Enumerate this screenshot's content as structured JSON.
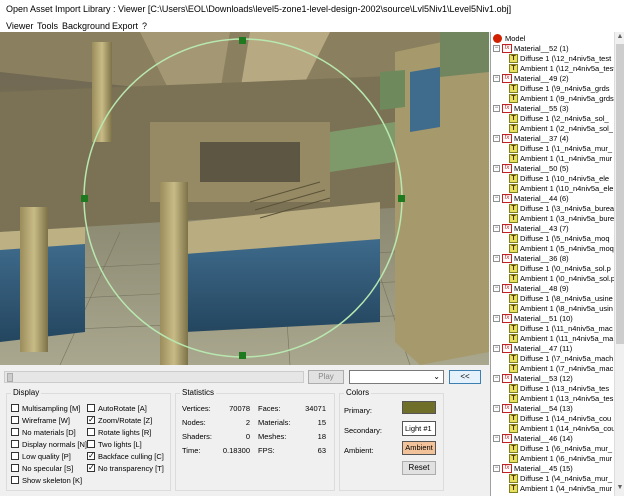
{
  "window": {
    "title": "Open Asset Import Library : Viewer  [C:\\Users\\EOL\\Downloads\\level5-zone1-level-design-2002\\source\\Lvl5Niv1\\Level5Niv1.obj]"
  },
  "menu": [
    "Viewer",
    "Tools",
    "Background",
    "Export",
    "?"
  ],
  "tree": {
    "root": "Model",
    "materials": [
      {
        "name": "Material__52 (1)",
        "diffuse": "Diffuse 1 (\\12_n4niv5a_test",
        "ambient": "Ambient 1 (\\12_n4niv5a_test"
      },
      {
        "name": "Material__49 (2)",
        "diffuse": "Diffuse 1 (\\9_n4niv5a_grds",
        "ambient": "Ambient 1 (\\9_n4niv5a_grds"
      },
      {
        "name": "Material__55 (3)",
        "diffuse": "Diffuse 1 (\\2_n4niv5a_sol_",
        "ambient": "Ambient 1 (\\2_n4niv5a_sol_"
      },
      {
        "name": "Material__37 (4)",
        "diffuse": "Diffuse 1 (\\1_n4niv5a_mur_",
        "ambient": "Ambient 1 (\\1_n4niv5a_mur"
      },
      {
        "name": "Material__50 (5)",
        "diffuse": "Diffuse 1 (\\10_n4niv5a_ele",
        "ambient": "Ambient 1 (\\10_n4niv5a_ele"
      },
      {
        "name": "Material__44 (6)",
        "diffuse": "Diffuse 1 (\\3_n4niv5a_burea",
        "ambient": "Ambient 1 (\\3_n4niv5a_bure"
      },
      {
        "name": "Material__43 (7)",
        "diffuse": "Diffuse 1 (\\5_n4niv5a_moq",
        "ambient": "Ambient 1 (\\5_n4niv5a_moq"
      },
      {
        "name": "Material__36 (8)",
        "diffuse": "Diffuse 1 (\\0_n4niv5a_sol.p",
        "ambient": "Ambient 1 (\\0_n4niv5a_sol.p"
      },
      {
        "name": "Material__48 (9)",
        "diffuse": "Diffuse 1 (\\8_n4niv5a_usine",
        "ambient": "Ambient 1 (\\8_n4niv5a_usin"
      },
      {
        "name": "Material__51 (10)",
        "diffuse": "Diffuse 1 (\\11_n4niv5a_mac",
        "ambient": "Ambient 1 (\\11_n4niv5a_ma"
      },
      {
        "name": "Material__47 (11)",
        "diffuse": "Diffuse 1 (\\7_n4niv5a_mach",
        "ambient": "Ambient 1 (\\7_n4niv5a_mac"
      },
      {
        "name": "Material__53 (12)",
        "diffuse": "Diffuse 1 (\\13_n4niv5a_tes",
        "ambient": "Ambient 1 (\\13_n4niv5a_tes"
      },
      {
        "name": "Material__54 (13)",
        "diffuse": "Diffuse 1 (\\14_n4niv5a_cou",
        "ambient": "Ambient 1 (\\14_n4niv5a_cou"
      },
      {
        "name": "Material__46 (14)",
        "diffuse": "Diffuse 1 (\\6_n4niv5a_mur_",
        "ambient": "Ambient 1 (\\6_n4niv5a_mur"
      },
      {
        "name": "Material__45 (15)",
        "diffuse": "Diffuse 1 (\\4_n4niv5a_mur_",
        "ambient": "Ambient 1 (\\4_n4niv5a_mur"
      }
    ]
  },
  "controls": {
    "play_label": "Play",
    "collapse_label": "<<"
  },
  "display": {
    "title": "Display",
    "left": [
      {
        "label": "Multisampling [M]",
        "checked": false
      },
      {
        "label": "Wireframe [W]",
        "checked": false
      },
      {
        "label": "No materials [D]",
        "checked": false
      },
      {
        "label": "Display normals [N]",
        "checked": false
      },
      {
        "label": "Low quality [P]",
        "checked": false
      },
      {
        "label": "No specular [S]",
        "checked": false
      },
      {
        "label": "Show skeleton [K]",
        "checked": false
      }
    ],
    "right": [
      {
        "label": "AutoRotate [A]",
        "checked": false
      },
      {
        "label": "Zoom/Rotate [Z]",
        "checked": true
      },
      {
        "label": "Rotate lights [R]",
        "checked": false
      },
      {
        "label": "Two lights [L]",
        "checked": false
      },
      {
        "label": "Backface culling [C]",
        "checked": true
      },
      {
        "label": "No transparency [T]",
        "checked": true
      }
    ]
  },
  "statistics": {
    "title": "Statistics",
    "left": [
      {
        "label": "Vertices:",
        "value": "70078"
      },
      {
        "label": "Nodes:",
        "value": "2"
      },
      {
        "label": "Shaders:",
        "value": "0"
      },
      {
        "label": "Time:",
        "value": "0.18300"
      }
    ],
    "right": [
      {
        "label": "Faces:",
        "value": "34071"
      },
      {
        "label": "Materials:",
        "value": "15"
      },
      {
        "label": "Meshes:",
        "value": "18"
      },
      {
        "label": "FPS:",
        "value": "63"
      }
    ]
  },
  "colors": {
    "title": "Colors",
    "primary_label": "Primary:",
    "secondary_label": "Secondary:",
    "ambient_label": "Ambient:",
    "primary_color": "#6f6f2a",
    "secondary_text": "Light #1",
    "ambient_text": "Ambient",
    "ambient_color": "#f2c39a",
    "reset_label": "Reset"
  }
}
